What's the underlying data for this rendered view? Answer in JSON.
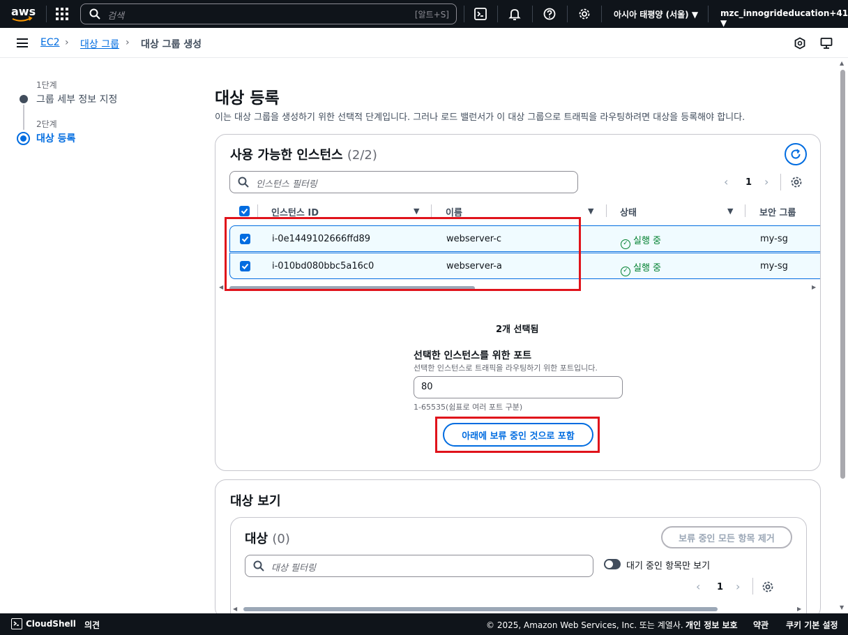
{
  "topbar": {
    "logo_text": "aws",
    "search_placeholder": "검색",
    "search_shortcut": "[알트+S]",
    "region": "아시아 태평양 (서울) ▼",
    "account": "mzc_innogrideducation+41 ▼"
  },
  "breadcrumb": {
    "ec2": "EC2",
    "target_groups": "대상 그룹",
    "current": "대상 그룹 생성"
  },
  "steps": [
    {
      "label": "1단계",
      "title": "그룹 세부 정보 지정"
    },
    {
      "label": "2단계",
      "title": "대상 등록"
    }
  ],
  "page": {
    "title": "대상 등록",
    "description": "이는 대상 그룹을 생성하기 위한 선택적 단계입니다. 그러나 로드 밸런서가 이 대상 그룹으로 트래픽을 라우팅하려면 대상을 등록해야 합니다."
  },
  "instances_panel": {
    "title": "사용 가능한 인스턴스",
    "count": "(2/2)",
    "filter_placeholder": "인스턴스 필터링",
    "page_number": "1",
    "columns": [
      "인스턴스 ID",
      "이름",
      "상태",
      "보안 그룹"
    ],
    "rows": [
      {
        "id": "i-0e1449102666ffd89",
        "name": "webserver-c",
        "status": "실행 중",
        "sg": "my-sg"
      },
      {
        "id": "i-010bd080bbc5a16c0",
        "name": "webserver-a",
        "status": "실행 중",
        "sg": "my-sg"
      }
    ],
    "selected_count": "2개 선택됨",
    "port_label": "선택한 인스턴스를 위한 포트",
    "port_hint": "선택한 인스턴스로 트래픽을 라우팅하기 위한 포트입니다.",
    "port_value": "80",
    "port_range": "1-65535(쉼표로 여러 포트 구분)",
    "include_button": "아래에 보류 중인 것으로 포함"
  },
  "review_panel": {
    "title": "대상 보기",
    "targets_title": "대상",
    "targets_count": "(0)",
    "remove_all_button": "보류 중인 모든 항목 제거",
    "filter_placeholder": "대상 필터링",
    "toggle_label": "대기 중인 항목만 보기",
    "page_number": "1"
  },
  "footer": {
    "cloudshell": "CloudShell",
    "feedback": "의견",
    "copyright": "© 2025, Amazon Web Services, Inc. 또는 계열사.",
    "privacy": "개인 정보 보호",
    "terms": "약관",
    "cookies": "쿠키 기본 설정"
  },
  "colors": {
    "accent": "#006ce0",
    "topbar_bg": "#0f141a",
    "highlight_red": "#e0131b",
    "status_green": "#00802f"
  }
}
